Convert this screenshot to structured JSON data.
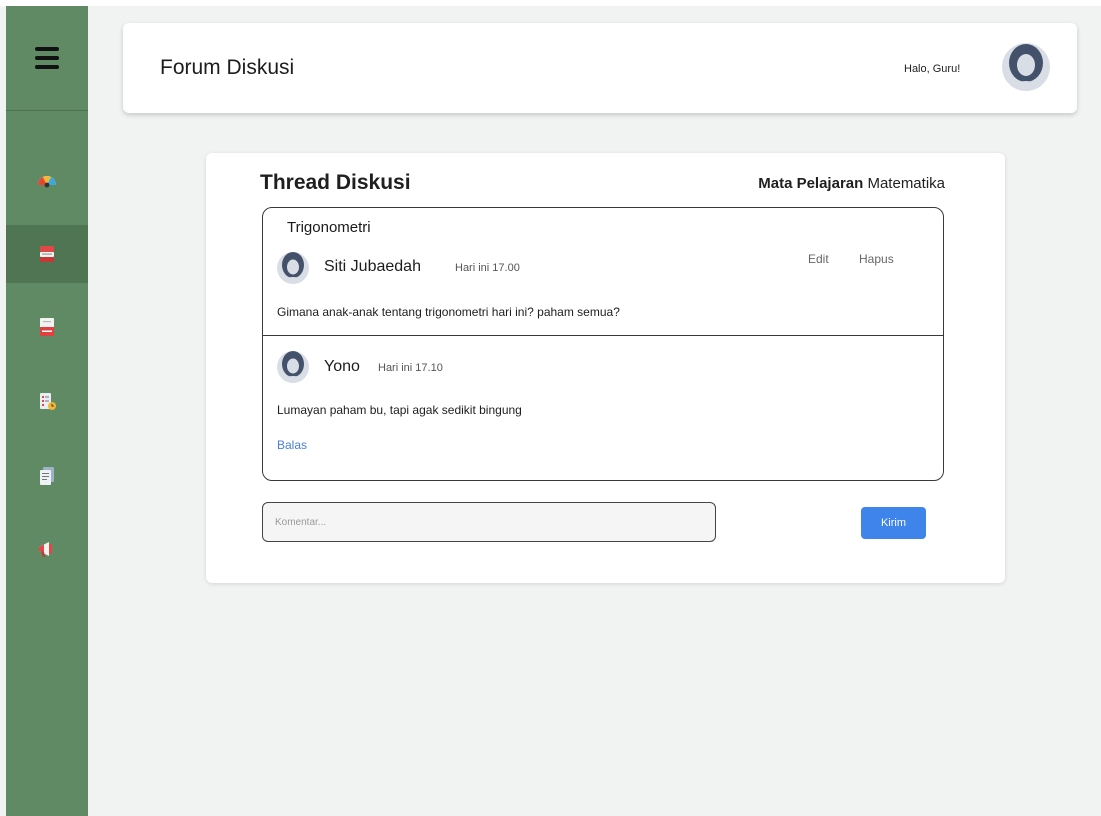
{
  "header": {
    "title": "Forum Diskusi",
    "greeting": "Halo, Guru!"
  },
  "sidebar": {
    "items": [
      {
        "icon": "dashboard-gauge-icon"
      },
      {
        "icon": "books-icon",
        "active": true
      },
      {
        "icon": "ebook-icon"
      },
      {
        "icon": "assignment-clock-icon"
      },
      {
        "icon": "document-icon"
      },
      {
        "icon": "megaphone-icon"
      }
    ]
  },
  "thread": {
    "heading": "Thread Diskusi",
    "subject_label": "Mata Pelajaran",
    "subject_value": "Matematika",
    "topic": "Trigonometri",
    "posts": [
      {
        "author": "Siti Jubaedah",
        "time": "Hari ini 17.00",
        "body": "Gimana anak-anak tentang trigonometri hari ini? paham semua?",
        "edit_label": "Edit",
        "delete_label": "Hapus"
      },
      {
        "author": "Yono",
        "time": "Hari ini 17.10",
        "body": "Lumayan paham bu, tapi agak sedikit bingung",
        "reply_label": "Balas"
      }
    ]
  },
  "comment": {
    "placeholder": "Komentar...",
    "send_label": "Kirim"
  },
  "colors": {
    "sidebar": "#5f8a64",
    "sidebar_active": "#4f7553",
    "accent": "#3f84ea",
    "link": "#4a7fd6"
  }
}
